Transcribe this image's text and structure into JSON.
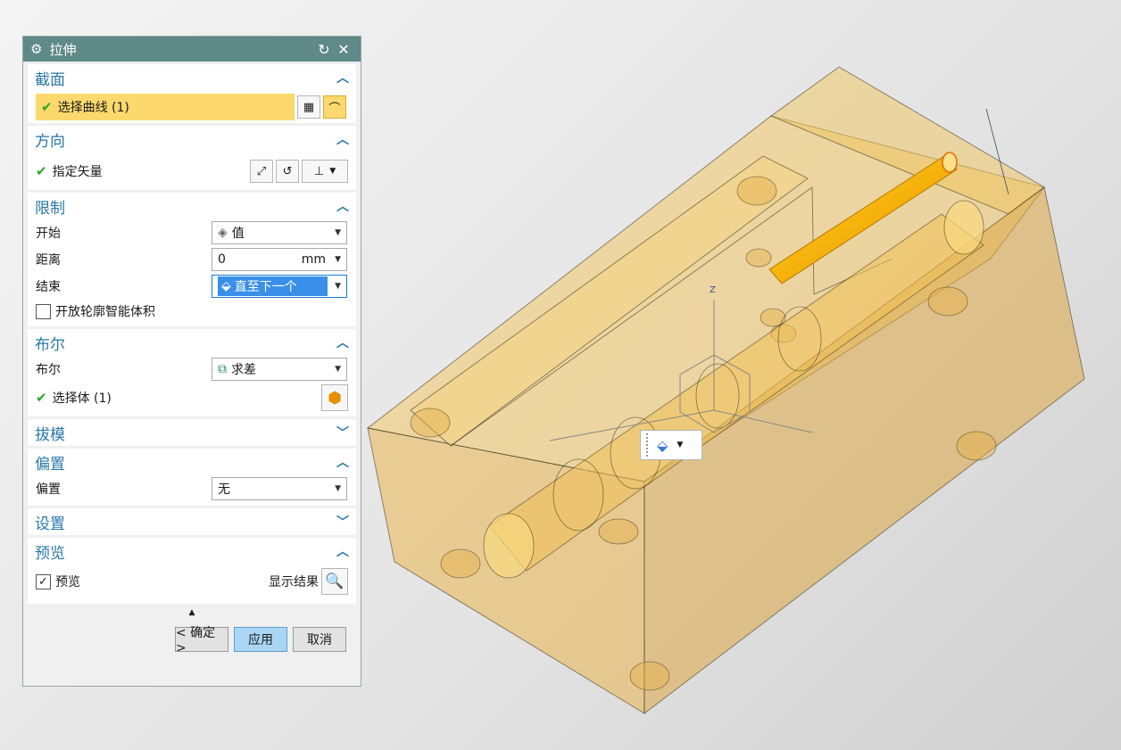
{
  "dialog": {
    "title": "拉伸",
    "sections": {
      "section": {
        "title": "截面",
        "select_curve": "选择曲线 (1)"
      },
      "direction": {
        "title": "方向",
        "specify_vector": "指定矢量"
      },
      "limits": {
        "title": "限制",
        "start_label": "开始",
        "start_value": "值",
        "distance_label": "距离",
        "distance_value": "0",
        "distance_unit": "mm",
        "end_label": "结束",
        "end_value": "直至下一个",
        "open_profile_label": "开放轮廓智能体积"
      },
      "boolean": {
        "title": "布尔",
        "boolean_label": "布尔",
        "boolean_value": "求差",
        "select_body": "选择体 (1)"
      },
      "draft": {
        "title": "拔模"
      },
      "offset": {
        "title": "偏置",
        "offset_label": "偏置",
        "offset_value": "无"
      },
      "settings": {
        "title": "设置"
      },
      "preview": {
        "title": "预览",
        "preview_label": "预览",
        "show_result": "显示结果"
      }
    },
    "buttons": {
      "ok": "< 确定 >",
      "apply": "应用",
      "cancel": "取消"
    }
  },
  "colors": {
    "title_bar": "#5f8a87",
    "section_title": "#2a78a8",
    "highlight": "#fcd86d",
    "model_fill": "#f0c050"
  }
}
